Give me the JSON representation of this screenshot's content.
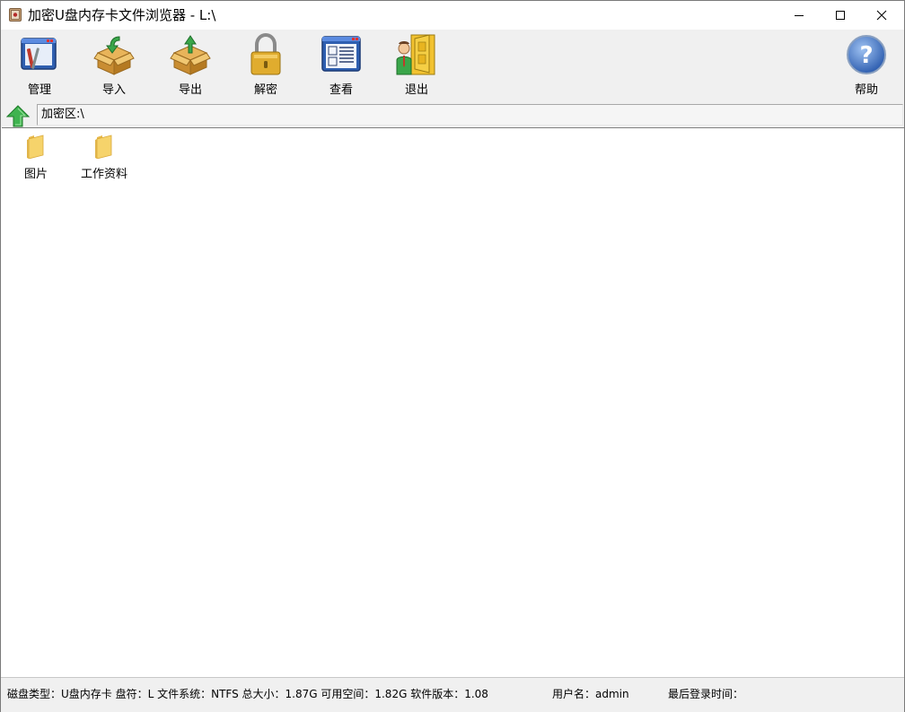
{
  "window": {
    "title": "加密U盘内存卡文件浏览器 - L:\\"
  },
  "toolbar": {
    "items": [
      {
        "label": "管理",
        "icon": "manage-icon"
      },
      {
        "label": "导入",
        "icon": "import-box-icon"
      },
      {
        "label": "导出",
        "icon": "export-box-icon"
      },
      {
        "label": "解密",
        "icon": "padlock-icon"
      },
      {
        "label": "查看",
        "icon": "view-document-icon"
      },
      {
        "label": "退出",
        "icon": "exit-door-icon"
      }
    ],
    "help": {
      "label": "帮助",
      "icon": "help-icon"
    }
  },
  "pathbar": {
    "path": "加密区:\\"
  },
  "files": [
    {
      "name": "图片",
      "icon": "folder-icon"
    },
    {
      "name": "工作资料",
      "icon": "folder-icon"
    }
  ],
  "status": {
    "disk_info": "磁盘类型：U盘内存卡  盘符：L  文件系统：NTFS  总大小：1.87G  可用空间：1.82G  软件版本：1.08",
    "username": "用户名：admin",
    "last_login": "最后登录时间："
  },
  "colors": {
    "toolbar_bg": "#f0f0f0",
    "folder": "#f6d36b",
    "up_arrow": "#3fb34f"
  }
}
